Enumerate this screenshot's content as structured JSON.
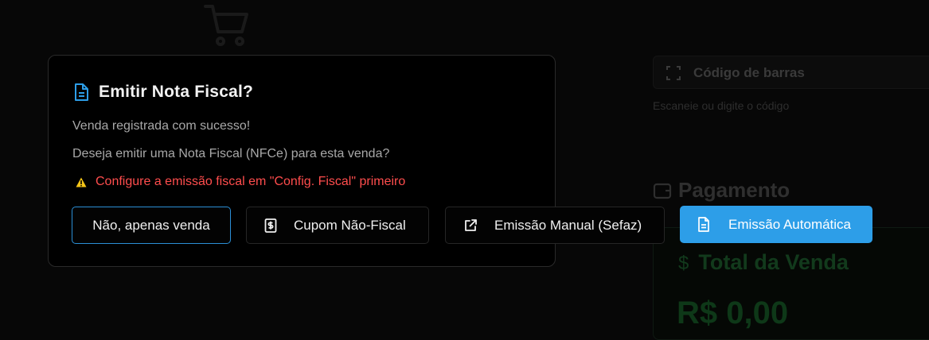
{
  "background": {
    "barcode": {
      "placeholder": "Código de barras",
      "help": "Escaneie ou digite o código"
    },
    "payment": {
      "title": "Pagamento",
      "total_label": "Total da Venda",
      "currency_symbol": "$",
      "total_value": "R$ 0,00"
    }
  },
  "modal": {
    "title": "Emitir Nota Fiscal?",
    "message_success": "Venda registrada com sucesso!",
    "message_question": "Deseja emitir uma Nota Fiscal (NFCe) para esta venda?",
    "warning": "Configure a emissão fiscal em \"Config. Fiscal\" primeiro",
    "buttons": {
      "no_invoice": "Não, apenas venda",
      "non_fiscal": "Cupom Não-Fiscal",
      "manual": "Emissão Manual (Sefaz)",
      "automatic": "Emissão Automática"
    }
  },
  "colors": {
    "accent": "#2d9ee8",
    "warning_text": "#ff4d4d",
    "warning_icon": "#f5c518"
  }
}
